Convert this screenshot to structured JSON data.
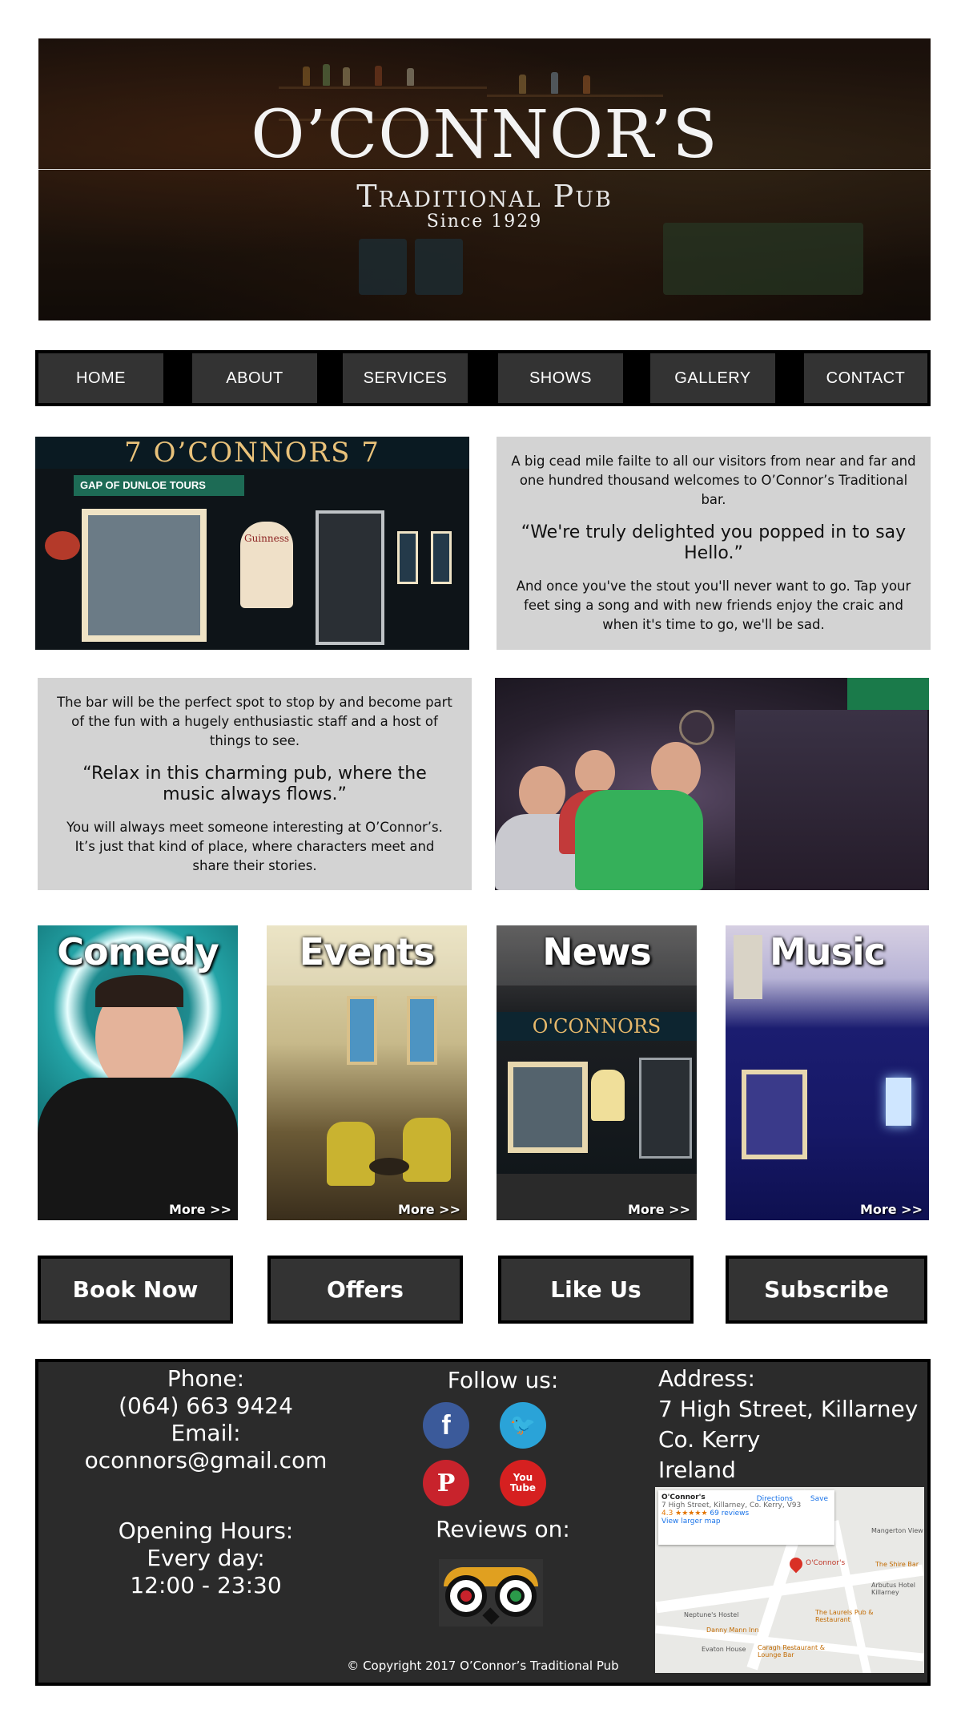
{
  "hero": {
    "title": "O’CONNOR’S",
    "subtitle": "Traditional Pub",
    "since": "Since 1929"
  },
  "nav": {
    "items": [
      {
        "label": "HOME"
      },
      {
        "label": "ABOUT"
      },
      {
        "label": "SERVICES"
      },
      {
        "label": "SHOWS"
      },
      {
        "label": "GALLERY"
      },
      {
        "label": "CONTACT"
      }
    ]
  },
  "intro": {
    "block1": {
      "para1": "A big cead mile failte to all our visitors from near and far and one hundred thousand welcomes to O’Connor’s Traditional bar.",
      "quote": "“We're truly delighted you popped in to say Hello.”",
      "para2": "And once you've the stout you'll never want to go. Tap your feet sing a song and with new friends enjoy the craic and when it's time to go, we'll be sad."
    },
    "block2": {
      "para1": "The bar will be the perfect spot to stop by and become part of the fun with a hugely enthusiastic staff and a host of things to see.",
      "quote": "“Relax in this charming pub, where the music always flows.”",
      "para2": "You will always meet someone interesting at O’Connor’s. It’s just that kind of place, where characters meet and share their stories."
    },
    "storefront": {
      "sign": "7   O’CONNORS   7",
      "tour_sign": "GAP OF DUNLOE TOURS",
      "plaque": "Guinness"
    }
  },
  "cards": [
    {
      "title": "Comedy",
      "more": "More >>"
    },
    {
      "title": "Events",
      "more": "More >>"
    },
    {
      "title": "News",
      "more": "More >>"
    },
    {
      "title": "Music",
      "more": "More >>"
    }
  ],
  "cta": [
    {
      "label": "Book Now"
    },
    {
      "label": "Offers"
    },
    {
      "label": "Like Us"
    },
    {
      "label": "Subscribe"
    }
  ],
  "footer": {
    "phone_label": "Phone:",
    "phone": "(064) 663 9424",
    "email_label": "Email:",
    "email": "oconnors@gmail.com",
    "hours_label": "Opening Hours:",
    "hours_days": "Every day:",
    "hours_time": "12:00 - 23:30",
    "follow_label": "Follow us:",
    "social": [
      {
        "name": "facebook-icon",
        "glyph": "f",
        "color": "#3b5a9a"
      },
      {
        "name": "twitter-icon",
        "glyph": "🐦",
        "color": "#2aa3d8"
      },
      {
        "name": "pinterest-icon",
        "glyph": "P",
        "color": "#c8232c"
      },
      {
        "name": "youtube-icon",
        "glyph": "You Tube",
        "color": "#d62020"
      }
    ],
    "reviews_label": "Reviews on:",
    "address_label": "Address:",
    "address_line1": "7 High Street, Killarney",
    "address_line2": "Co. Kerry",
    "address_line3": "Ireland",
    "map": {
      "place": "O'Connor's",
      "place_address": "7 High Street, Killarney, Co. Kerry, V93",
      "rating": "4.3 ★★★★★",
      "reviews": "69 reviews",
      "directions": "Directions",
      "save": "Save",
      "larger_map": "View larger map",
      "labels": [
        "Mangerton View",
        "The Shire Bar",
        "Neptune's Hostel",
        "Danny Mann Inn",
        "Evaton House",
        "The Laurels Pub & Restaurant",
        "Caragh Restaurant & Lounge Bar",
        "Arbutus Hotel Killarney",
        "O'Connor's"
      ]
    },
    "copyright": "© Copyright 2017 O’Connor’s Traditional Pub"
  },
  "colors": {
    "nav_bg": "#000000",
    "nav_item": "#333333",
    "textbox": "#d3d3d3",
    "footer": "#2b2b2b"
  }
}
